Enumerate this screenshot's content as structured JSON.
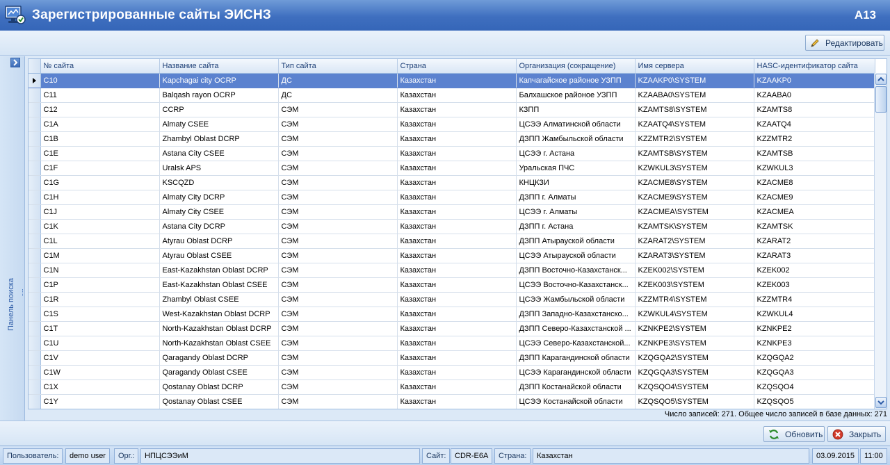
{
  "window": {
    "title": "Зарегистрированные сайты ЭИСНЗ",
    "code": "A13"
  },
  "toolbar": {
    "edit_label": "Редактировать"
  },
  "search_panel": {
    "label": "Панель поиска"
  },
  "grid": {
    "columns": [
      "№ сайта",
      "Название сайта",
      "Тип сайта",
      "Страна",
      "Организация (сокращение)",
      "Имя сервера",
      "HASC-идентификатор сайта"
    ],
    "selected_row": 0,
    "rows": [
      [
        "C10",
        "Kapchagai city OCRP",
        "ДС",
        "Казахстан",
        "Капчагайское районое УЗПП",
        "KZAAKP0\\SYSTEM",
        "KZAAKP0"
      ],
      [
        "C11",
        "Balqash rayon OCRP",
        "ДС",
        "Казахстан",
        "Балхашское районое УЗПП",
        "KZAABA0\\SYSTEM",
        "KZAABA0"
      ],
      [
        "C12",
        "CCRP",
        "СЭМ",
        "Казахстан",
        "КЗПП",
        "KZAMTS8\\SYSTEM",
        "KZAMTS8"
      ],
      [
        "C1A",
        "Almaty CSEE",
        "СЭМ",
        "Казахстан",
        "ЦСЭЭ Алматинской области",
        "KZAATQ4\\SYSTEM",
        "KZAATQ4"
      ],
      [
        "C1B",
        "Zhambyl Oblast DCRP",
        "СЭМ",
        "Казахстан",
        "ДЗПП Жамбыльской области",
        "KZZMTR2\\SYSTEM",
        "KZZMTR2"
      ],
      [
        "C1E",
        "Astana City CSEE",
        "СЭМ",
        "Казахстан",
        "ЦСЭЭ г. Астана",
        "KZAMTSB\\SYSTEM",
        "KZAMTSB"
      ],
      [
        "C1F",
        "Uralsk APS",
        "СЭМ",
        "Казахстан",
        "Уральская ПЧС",
        "KZWKUL3\\SYSTEM",
        "KZWKUL3"
      ],
      [
        "C1G",
        "KSCQZD",
        "СЭМ",
        "Казахстан",
        "КНЦКЗИ",
        "KZACME8\\SYSTEM",
        "KZACME8"
      ],
      [
        "C1H",
        "Almaty City DCRP",
        "СЭМ",
        "Казахстан",
        "ДЗПП г. Алматы",
        "KZACME9\\SYSTEM",
        "KZACME9"
      ],
      [
        "C1J",
        "Almaty City CSEE",
        "СЭМ",
        "Казахстан",
        "ЦСЭЭ г. Алматы",
        "KZACMEA\\SYSTEM",
        "KZACMEA"
      ],
      [
        "C1K",
        "Astana City DCRP",
        "СЭМ",
        "Казахстан",
        "ДЗПП г. Астана",
        "KZAMTSK\\SYSTEM",
        "KZAMTSK"
      ],
      [
        "C1L",
        "Atyrau Oblast DCRP",
        "СЭМ",
        "Казахстан",
        "ДЗПП Атырауской области",
        "KZARAT2\\SYSTEM",
        "KZARAT2"
      ],
      [
        "C1M",
        "Atyrau Oblast CSEE",
        "СЭМ",
        "Казахстан",
        "ЦСЭЭ Атырауской области",
        "KZARAT3\\SYSTEM",
        "KZARAT3"
      ],
      [
        "C1N",
        "East-Kazakhstan Oblast DCRP",
        "СЭМ",
        "Казахстан",
        "ДЗПП Восточно-Казахстанск...",
        "KZEK002\\SYSTEM",
        "KZEK002"
      ],
      [
        "C1P",
        "East-Kazakhstan Oblast CSEE",
        "СЭМ",
        "Казахстан",
        "ЦСЭЭ Восточно-Казахстанск...",
        "KZEK003\\SYSTEM",
        "KZEK003"
      ],
      [
        "C1R",
        "Zhambyl Oblast CSEE",
        "СЭМ",
        "Казахстан",
        "ЦСЭЭ Жамбыльской области",
        "KZZMTR4\\SYSTEM",
        "KZZMTR4"
      ],
      [
        "C1S",
        "West-Kazakhstan Oblast DCRP",
        "СЭМ",
        "Казахстан",
        "ДЗПП Западно-Казахстанско...",
        "KZWKUL4\\SYSTEM",
        "KZWKUL4"
      ],
      [
        "C1T",
        "North-Kazakhstan Oblast DCRP",
        "СЭМ",
        "Казахстан",
        "ДЗПП Северо-Казахстанской ...",
        "KZNKPE2\\SYSTEM",
        "KZNKPE2"
      ],
      [
        "C1U",
        "North-Kazakhstan Oblast CSEE",
        "СЭМ",
        "Казахстан",
        "ЦСЭЭ Северо-Казахстанской...",
        "KZNKPE3\\SYSTEM",
        "KZNKPE3"
      ],
      [
        "C1V",
        "Qaragandy Oblast DCRP",
        "СЭМ",
        "Казахстан",
        "ДЗПП Карагандинской области",
        "KZQGQA2\\SYSTEM",
        "KZQGQA2"
      ],
      [
        "C1W",
        "Qaragandy Oblast CSEE",
        "СЭМ",
        "Казахстан",
        "ЦСЭЭ Карагандинской области",
        "KZQGQA3\\SYSTEM",
        "KZQGQA3"
      ],
      [
        "C1X",
        "Qostanay Oblast DCRP",
        "СЭМ",
        "Казахстан",
        "ДЗПП Костанайской области",
        "KZQSQO4\\SYSTEM",
        "KZQSQO4"
      ],
      [
        "C1Y",
        "Qostanay Oblast CSEE",
        "СЭМ",
        "Казахстан",
        "ЦСЭЭ Костанайской области",
        "KZQSQO5\\SYSTEM",
        "KZQSQO5"
      ]
    ]
  },
  "record_info": "Число записей: 271. Общее число записей в базе данных: 271",
  "buttons": {
    "refresh_label": "Обновить",
    "close_label": "Закрыть"
  },
  "status": {
    "user_label": "Пользователь:",
    "user_value": "demo user",
    "org_label": "Орг.:",
    "org_value": "НПЦСЭЭиМ",
    "site_label": "Сайт:",
    "site_value": "CDR-E6A",
    "country_label": "Страна:",
    "country_value": "Казахстан",
    "date": "03.09.2015",
    "time": "11:00"
  },
  "colors": {
    "title_bar": "#3f6fbf",
    "selected_row": "#5b82cf",
    "header_text": "#1d3f76"
  }
}
